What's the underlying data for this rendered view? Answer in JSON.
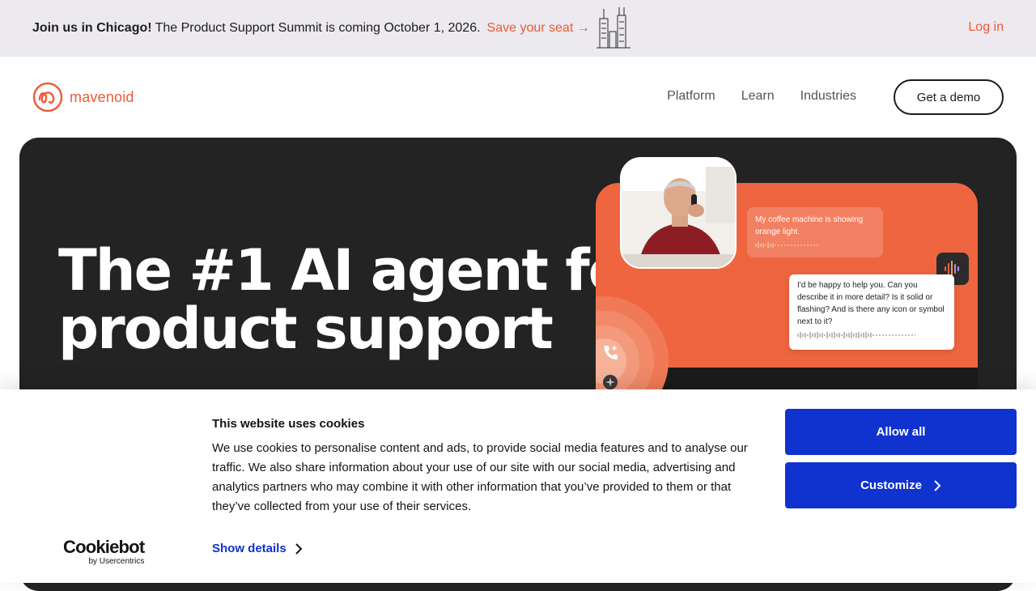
{
  "announcement": {
    "bold": "Join us in Chicago!",
    "text": "The Product Support Summit is coming October 1, 2026.",
    "cta": "Save your seat →",
    "login": "Log in"
  },
  "header": {
    "brand": "mavenoid",
    "nav": [
      "Platform",
      "Learn",
      "Industries"
    ],
    "demo": "Get a demo"
  },
  "hero": {
    "title_line1": "The #1 AI agent for",
    "title_line2": "product support",
    "chat": {
      "customer_message": "My coffee machine is showing orange light.",
      "agent_message": "I'd be happy to help you. Can you describe it in more detail? Is it solid or flashing? And is there any icon or symbol next to it?"
    }
  },
  "cookie": {
    "title": "This website uses cookies",
    "body": "We use cookies to personalise content and ads, to provide social media features and to analyse our traffic. We also share information about your use of our site with our social media, advertising and analytics partners who may combine it with other information that you’ve provided to them or that they’ve collected from your use of their services.",
    "show_details": "Show details",
    "allow_all": "Allow all",
    "customize": "Customize",
    "brand": "Cookiebot",
    "brand_by": "by Usercentrics"
  },
  "colors": {
    "accent": "#ee5a35",
    "hero_bg": "#232323",
    "cookie_button": "#1032cf",
    "announce_bg": "#ece9ef"
  },
  "icons": [
    "chicago-skyline-icon",
    "mavenoid-logo-icon",
    "voice-wave-icon",
    "phone-icon",
    "sparkle-icon",
    "chevron-right-icon"
  ]
}
